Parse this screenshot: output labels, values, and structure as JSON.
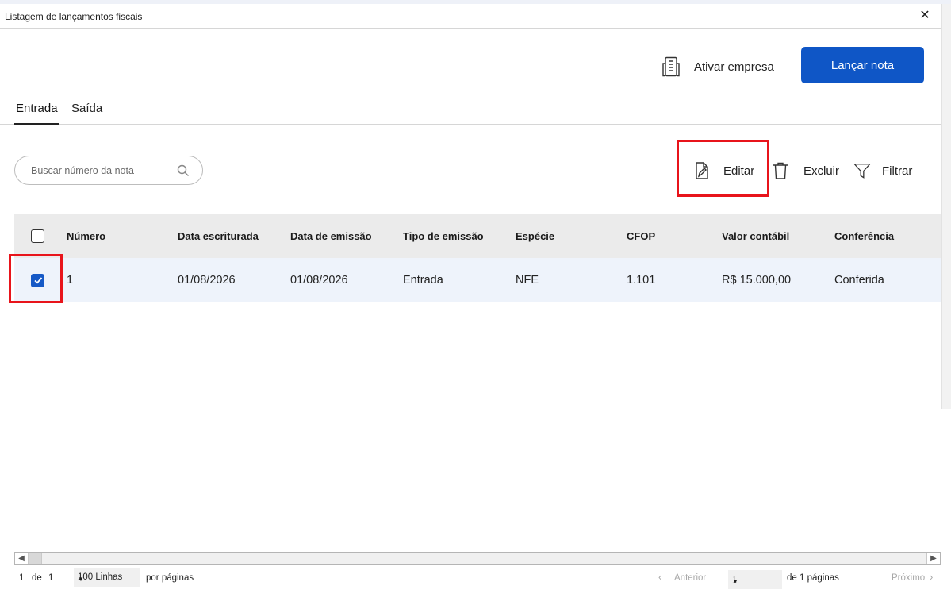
{
  "window": {
    "title": "Listagem de lançamentos fiscais",
    "close_symbol": "✕"
  },
  "header": {
    "ativar_label": "Ativar empresa",
    "lancar_label": "Lançar nota"
  },
  "tabs": [
    {
      "label": "Entrada",
      "active": true
    },
    {
      "label": "Saída",
      "active": false
    }
  ],
  "search": {
    "placeholder": "Buscar número da nota",
    "value": ""
  },
  "toolbar": {
    "editar_label": "Editar",
    "excluir_label": "Excluir",
    "filtrar_label": "Filtrar"
  },
  "table": {
    "columns": [
      "Número",
      "Data escriturada",
      "Data de emissão",
      "Tipo de emissão",
      "Espécie",
      "CFOP",
      "Valor contábil",
      "Conferência"
    ],
    "rows": [
      {
        "checked": true,
        "cells": [
          "1",
          "01/08/2026",
          "01/08/2026",
          "Entrada",
          "NFE",
          "1.101",
          "R$ 15.000,00",
          "Conferida"
        ]
      }
    ]
  },
  "pagination": {
    "current": "1",
    "de": "de",
    "total": "1",
    "rows_per_page": "100 Linhas",
    "por_paginas": "por páginas",
    "anterior": "Anterior",
    "page_value": "1",
    "de_paginas": "de 1 páginas",
    "proximo": "Próximo"
  },
  "colors": {
    "primary": "#0f56c6",
    "highlight": "#e8141b",
    "selected_row": "#eef3fb",
    "header_bg": "#ebebeb"
  },
  "icons": [
    "close-icon",
    "building-icon",
    "search-icon",
    "edit-icon",
    "trash-icon",
    "filter-icon",
    "check-icon",
    "chevron-left-icon",
    "chevron-right-icon",
    "caret-down-icon"
  ]
}
